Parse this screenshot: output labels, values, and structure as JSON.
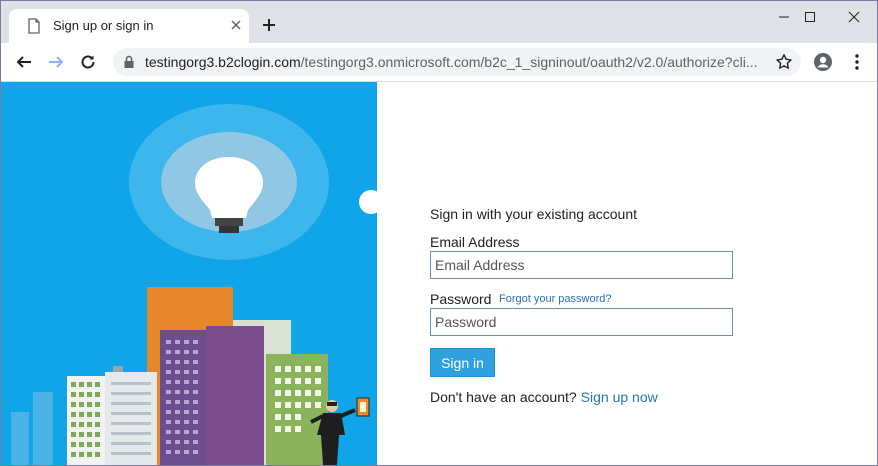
{
  "browser": {
    "tab_title": "Sign up or sign in",
    "url_host": "testingorg3.b2clogin.com",
    "url_path": "/testingorg3.onmicrosoft.com/b2c_1_signinout/oauth2/v2.0/authorize?cli...",
    "icons": [
      "page-icon",
      "close-icon",
      "plus-icon",
      "minimize-icon",
      "maximize-icon",
      "close-window-icon",
      "back-arrow-icon",
      "forward-arrow-icon",
      "reload-icon",
      "lock-icon",
      "star-icon",
      "profile-icon",
      "more-menu-icon"
    ]
  },
  "signin": {
    "heading": "Sign in with your existing account",
    "email_label": "Email Address",
    "email_placeholder": "Email Address",
    "password_label": "Password",
    "forgot_link": "Forgot your password?",
    "password_placeholder": "Password",
    "signin_button": "Sign in",
    "no_account_text": "Don't have an account?",
    "signup_link": "Sign up now"
  },
  "colors": {
    "hero_background": "#0fa5e8",
    "button": "#2ea1e0",
    "link": "#2872b4"
  }
}
